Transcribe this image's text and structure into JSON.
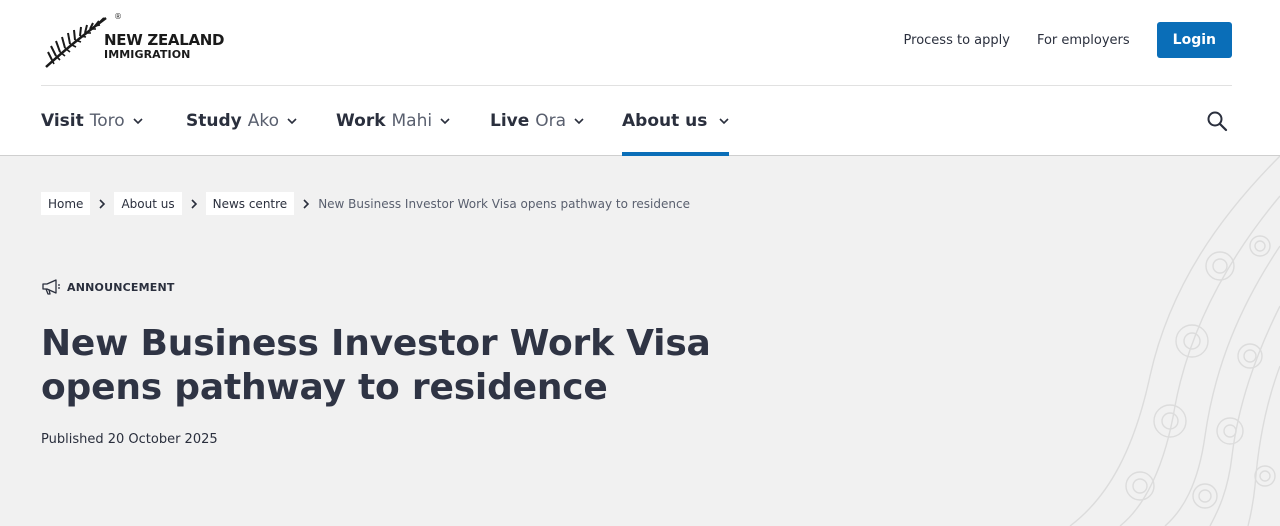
{
  "header": {
    "logo": {
      "line1": "NEW ZEALAND",
      "line2": "IMMIGRATION",
      "reg": "®"
    },
    "links": {
      "process": "Process to apply",
      "employers": "For employers"
    },
    "login_label": "Login"
  },
  "nav": {
    "items": [
      {
        "label": "Visit",
        "maori": "Toro"
      },
      {
        "label": "Study",
        "maori": "Ako"
      },
      {
        "label": "Work",
        "maori": "Mahi"
      },
      {
        "label": "Live",
        "maori": "Ora"
      },
      {
        "label": "About us",
        "maori": ""
      }
    ],
    "active_item": "About us"
  },
  "breadcrumb": {
    "items": [
      "Home",
      "About us",
      "News centre"
    ],
    "current": "New Business Investor Work Visa opens pathway to residence"
  },
  "article": {
    "tag": "ANNOUNCEMENT",
    "title_line1": "New Business Investor Work Visa",
    "title_line2": "opens pathway to residence",
    "published": "Published 20 October 2025"
  },
  "colors": {
    "accent": "#0a6eb8",
    "text": "#2a2f3d",
    "hero_bg": "#f1f1f1"
  },
  "icons": {
    "logo": "silver-fern-icon",
    "search": "search-icon",
    "announcement": "megaphone-icon",
    "chevron": "chevron-down-icon",
    "separator": "chevron-right-icon"
  }
}
